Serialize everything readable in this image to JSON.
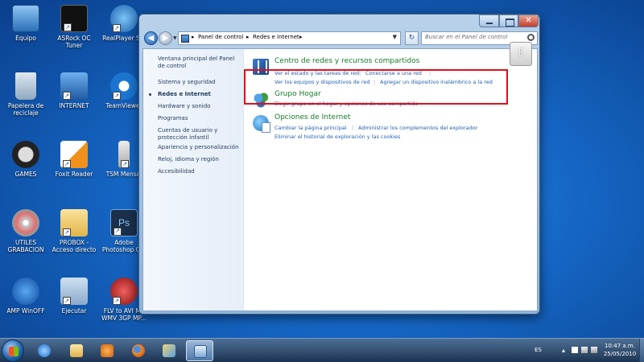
{
  "desktop": {
    "icons": [
      {
        "label": "Equipo"
      },
      {
        "label": "ASRock OC Tuner"
      },
      {
        "label": "RealPlayer S..."
      },
      {
        "label": "Papelera de reciclaje"
      },
      {
        "label": "INTERNET"
      },
      {
        "label": "TeamViewer"
      },
      {
        "label": "GAMES"
      },
      {
        "label": "Foxit Reader"
      },
      {
        "label": "TSM Mensaj"
      },
      {
        "label": "UTILES GRABACION"
      },
      {
        "label": "PROBOX - Acceso directo"
      },
      {
        "label": "Adobe Photoshop C..."
      },
      {
        "label": "AMP WinOFF"
      },
      {
        "label": "Ejecutar"
      },
      {
        "label": "FLV to AVI MP WMV 3GP MP..."
      }
    ]
  },
  "window": {
    "breadcrumb": [
      "Panel de control",
      "Redes e Internet"
    ],
    "search_placeholder": "Buscar en el Panel de control",
    "close_glyph": "✕",
    "sidebar": {
      "items": [
        {
          "label": "Ventana principal del Panel de control"
        },
        {
          "label": "Sistema y seguridad"
        },
        {
          "label": "Redes e Internet"
        },
        {
          "label": "Hardware y sonido"
        },
        {
          "label": "Programas"
        },
        {
          "label": "Cuentas de usuario y protección infantil"
        },
        {
          "label": "Apariencia y personalización"
        },
        {
          "label": "Reloj, idioma y región"
        },
        {
          "label": "Accesibilidad"
        }
      ]
    },
    "sections": [
      {
        "title": "Centro de redes y recursos compartidos",
        "links": [
          "Ver el estado y las tareas de red",
          "Conectarse a una red",
          "Ver los equipos y dispositivos de red",
          "Agregar un dispositivo inalámbrico a la red"
        ]
      },
      {
        "title": "Grupo Hogar",
        "links": [
          "Elegir grupo en el hogar y opciones de uso compartido"
        ]
      },
      {
        "title": "Opciones de Internet",
        "links": [
          "Cambiar la página principal",
          "Administrar los complementos del explorador",
          "Eliminar el historial de exploración y las cookies"
        ]
      }
    ]
  },
  "taskbar": {
    "language": "ES",
    "time": "10:47 a.m.",
    "date": "25/05/2010"
  },
  "colors": {
    "section_title": "#157a2c",
    "link": "#1f5db0",
    "highlight_border": "#e0101a"
  }
}
